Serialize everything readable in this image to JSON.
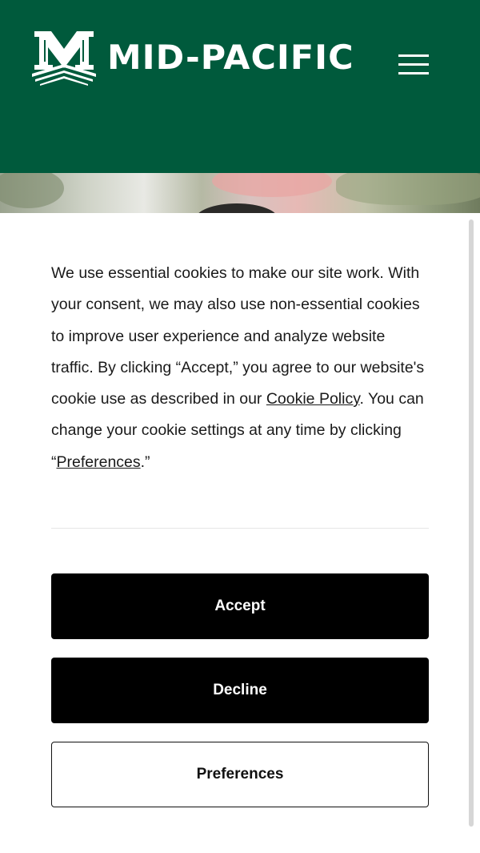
{
  "header": {
    "brand_name": "MID-PACIFIC",
    "logo_icon": "mid-pacific-m-logo",
    "menu_icon": "hamburger-menu-icon",
    "background_color": "#005a3c"
  },
  "cookie_banner": {
    "text_before_policy": "We use essential cookies to make our site work. With your consent, we may also use non-essential cookies to improve user experience and analyze website traffic. By clicking “Accept,” you agree to our website's cookie use as described in our ",
    "policy_link": "Cookie Policy",
    "text_after_policy": ". You can change your cookie settings at any time by clicking “",
    "preferences_link": "Preferences",
    "text_end": ".”",
    "buttons": {
      "accept": "Accept",
      "decline": "Decline",
      "preferences": "Preferences"
    }
  }
}
